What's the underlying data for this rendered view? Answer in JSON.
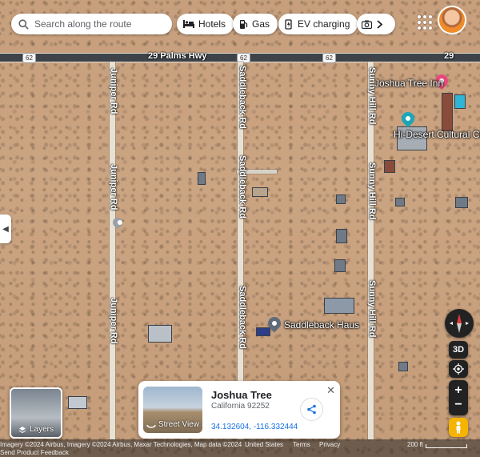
{
  "search": {
    "placeholder": "Search along the route"
  },
  "chips": [
    {
      "label": "Hotels",
      "icon": "bed-icon"
    },
    {
      "label": "Gas",
      "icon": "gas-pump-icon"
    },
    {
      "label": "EV charging",
      "icon": "ev-charger-icon"
    }
  ],
  "map": {
    "roads": {
      "highway": "29 Palms Hwy",
      "highway_end_label": "29",
      "shield_number": "62",
      "juniper_top": "Juniper Rd",
      "juniper_mid": "Juniper Rd",
      "juniper_bottom": "Juniper Rd",
      "saddleback_top": "Saddleback Rd",
      "saddleback_mid": "Saddleback Rd",
      "saddleback_bottom": "Saddleback Rd",
      "sunny_top": "Sunny Hill Rd",
      "sunny_mid": "Sunny Hill Rd",
      "sunny_bottom": "Sunny Hill Rd"
    },
    "places": {
      "inn": "Joshua Tree Inn",
      "cultural": "Hi-Desert Cultural Center",
      "haus": "Saddleback Haus"
    },
    "colors": {
      "inn_pin": "#e64a7a",
      "cultural_pin": "#1aa6b7",
      "haus_pin": "#5f6b7a",
      "dropped_pin": "#9aa0a6"
    }
  },
  "controls": {
    "view_3d": "3D",
    "zoom_in": "+",
    "zoom_out": "−"
  },
  "layers": {
    "label": "Layers"
  },
  "card": {
    "title": "Joshua Tree",
    "subtitle": "California 92252",
    "coords": "34.132604, -116.332444",
    "street_view": "Street View",
    "close": "✕"
  },
  "footer": {
    "attribution": "Imagery ©2024 Airbus, Imagery ©2024 Airbus, Maxar Technologies, Map data ©2024",
    "country": "United States",
    "terms": "Terms",
    "privacy": "Privacy",
    "scale": "200 ft",
    "feedback": "Send Product Feedback"
  }
}
